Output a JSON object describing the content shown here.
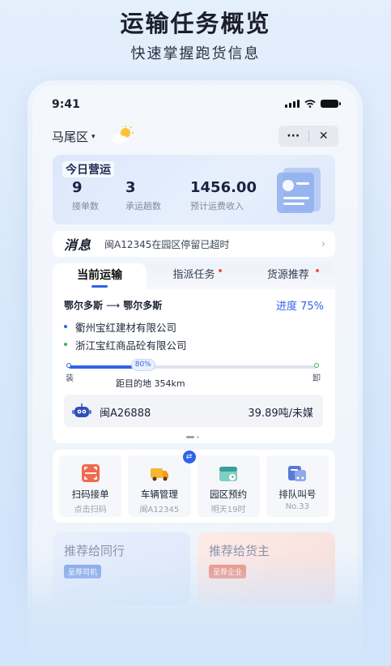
{
  "hero": {
    "title": "运输任务概览",
    "subtitle": "快速掌握跑货信息"
  },
  "status_bar": {
    "time": "9:41"
  },
  "location": {
    "name": "马尾区",
    "caret": "▾",
    "weather_icon": "sun-cloud-icon"
  },
  "capsule": {
    "more": "···",
    "close": "✕"
  },
  "today": {
    "tag": "今日营运",
    "stats": [
      {
        "value": "9",
        "label": "接单数"
      },
      {
        "value": "3",
        "label": "承运趟数"
      },
      {
        "value": "1456.00",
        "label": "预计运费收入"
      }
    ]
  },
  "message": {
    "title": "消息",
    "text": "闽A12345在园区停留已超时",
    "arrow": "›"
  },
  "tabs": [
    {
      "label": "当前运输",
      "active": true,
      "dot": false
    },
    {
      "label": "指派任务",
      "active": false,
      "dot": true
    },
    {
      "label": "货源推荐",
      "active": false,
      "dot": true
    }
  ],
  "transport": {
    "from": "鄂尔多斯",
    "arrow": "⟶",
    "to": "鄂尔多斯",
    "progress_text": "进度 75%",
    "stops": [
      {
        "name": "衢州宝红建材有限公司",
        "color": "#2f63e8"
      },
      {
        "name": "浙江宝红商品砼有限公司",
        "color": "#3bb36a"
      }
    ],
    "bar_progress": 0.3,
    "bar_pct_text": "80%",
    "start_label": "装",
    "end_label": "卸",
    "distance": "距目的地 354km",
    "vehicle": {
      "plate": "闽A26888",
      "cargo": "39.89吨/未媒",
      "icon": "robot-icon"
    }
  },
  "actions": [
    {
      "name": "扫码接单",
      "sub": "点击扫码",
      "icon": "qr-scan-icon"
    },
    {
      "name": "车辆管理",
      "sub": "闽A12345",
      "icon": "truck-icon",
      "badge": "⇄"
    },
    {
      "name": "园区预约",
      "sub": "明天19时",
      "icon": "calendar-icon"
    },
    {
      "name": "排队叫号",
      "sub": "No.33",
      "icon": "queue-icon"
    }
  ],
  "recommend": [
    {
      "title": "推荐给同行",
      "tag": "呈荐司机",
      "color": "#7ea2e8"
    },
    {
      "title": "推荐给货主",
      "tag": "呈荐企业",
      "color": "#f08b7a"
    }
  ]
}
